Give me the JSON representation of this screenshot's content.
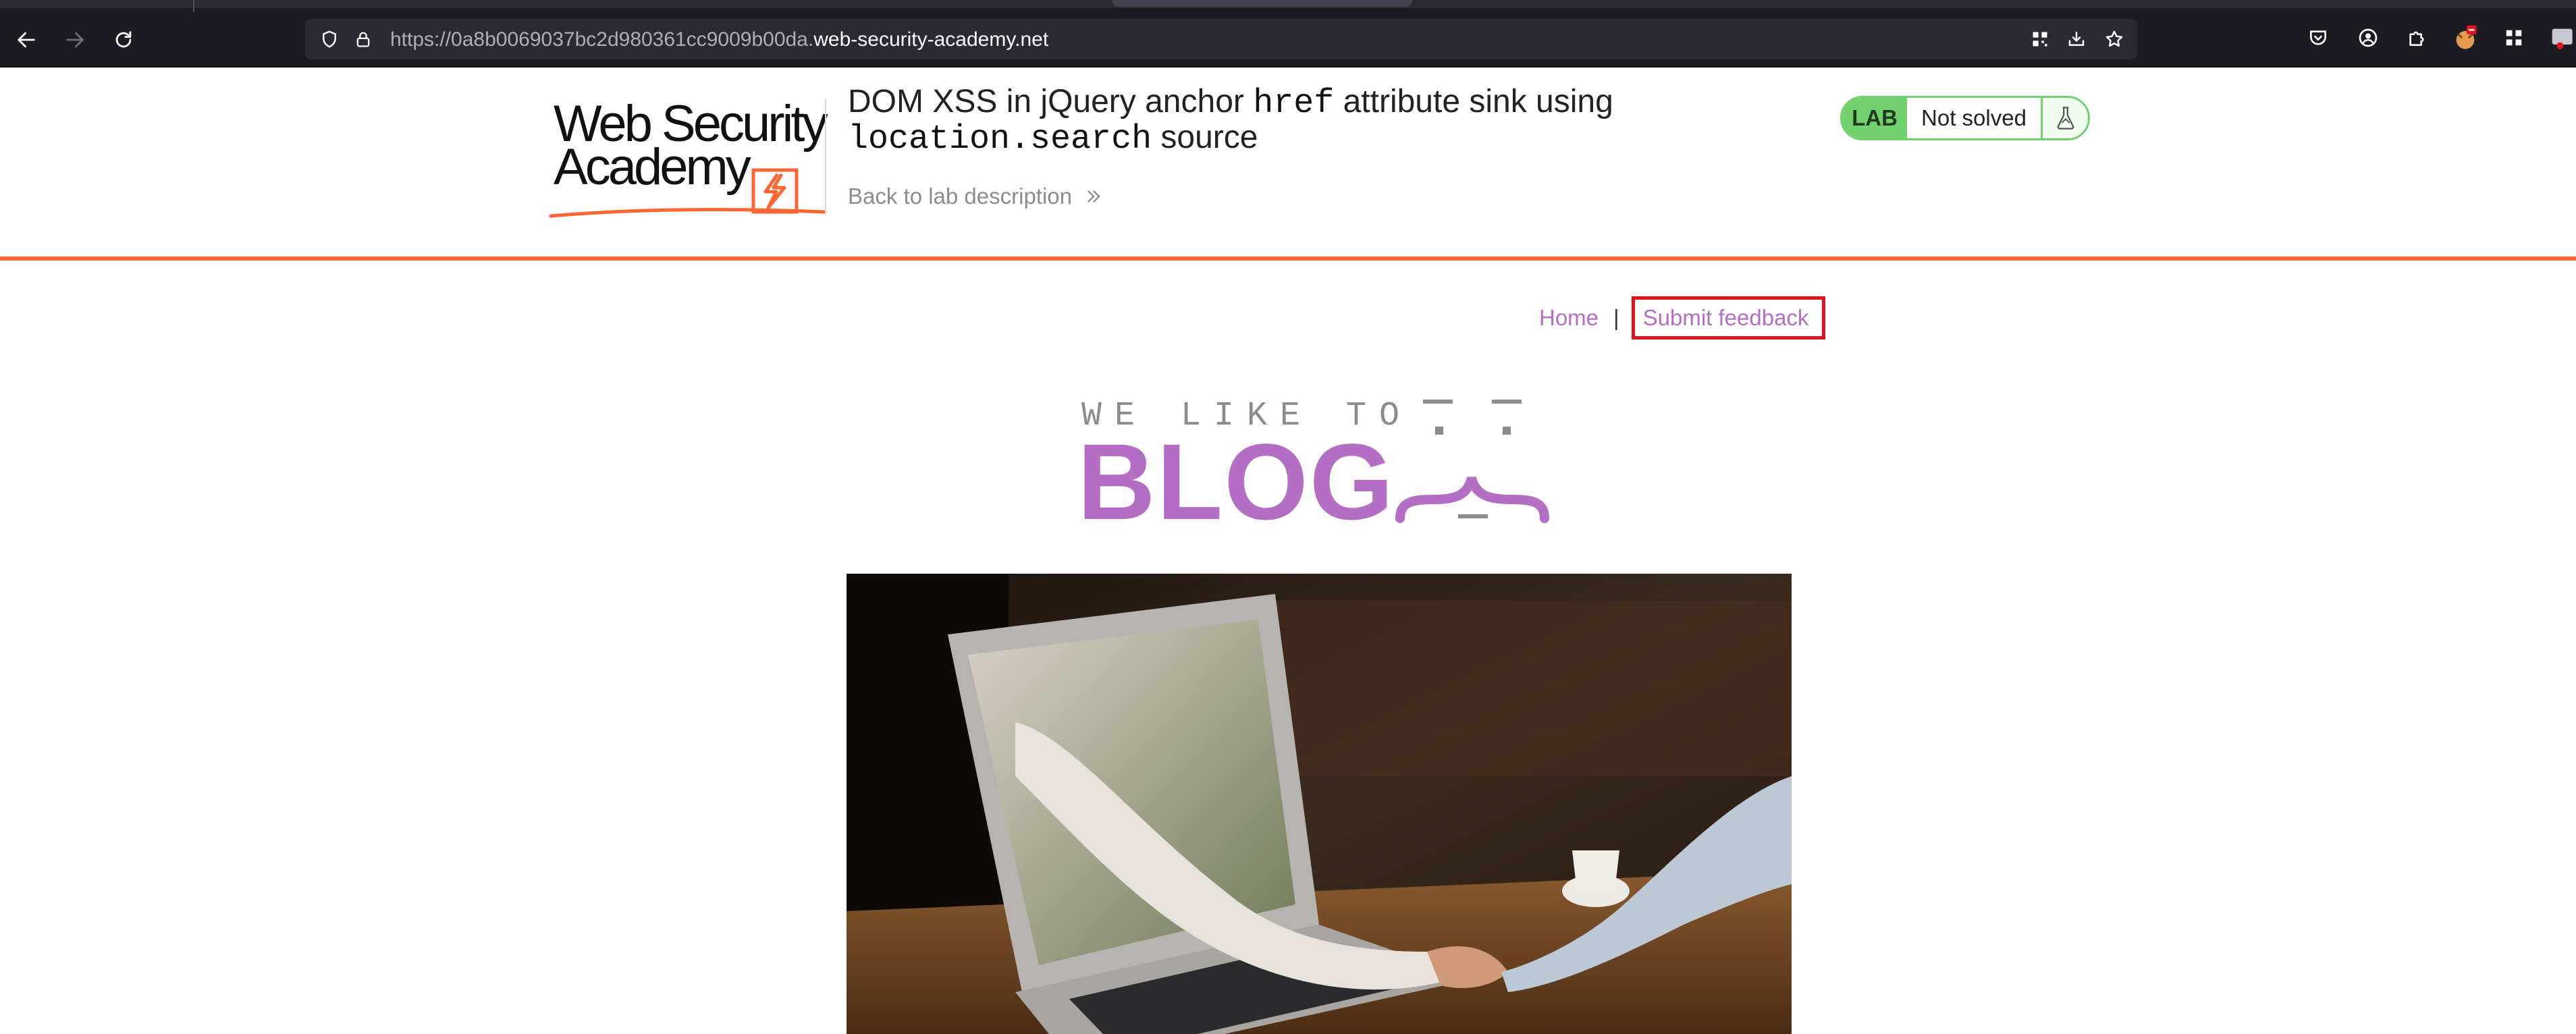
{
  "browser": {
    "url_prefix": "https://0a8b0069037bc2d980361cc9009b00da.",
    "url_host": "web-security-academy.net"
  },
  "lab": {
    "logo_line1": "Web Security",
    "logo_line2": "Academy",
    "title_part1": "DOM XSS in jQuery anchor ",
    "title_code1": "href",
    "title_part2": " attribute sink using",
    "title_code2": "location.search",
    "title_part3": " source",
    "back_link": "Back to lab description",
    "status_tag": "LAB",
    "status_text": "Not solved",
    "accent_color": "#ff6633",
    "status_color": "#70d16d"
  },
  "nav": {
    "home": "Home",
    "separator": "|",
    "feedback": "Submit feedback",
    "link_color": "#b46fc4"
  },
  "banner": {
    "tagline": "WE LIKE TO",
    "word": "BLOG"
  },
  "hero": {
    "image": "handshake-through-laptop-photo"
  }
}
